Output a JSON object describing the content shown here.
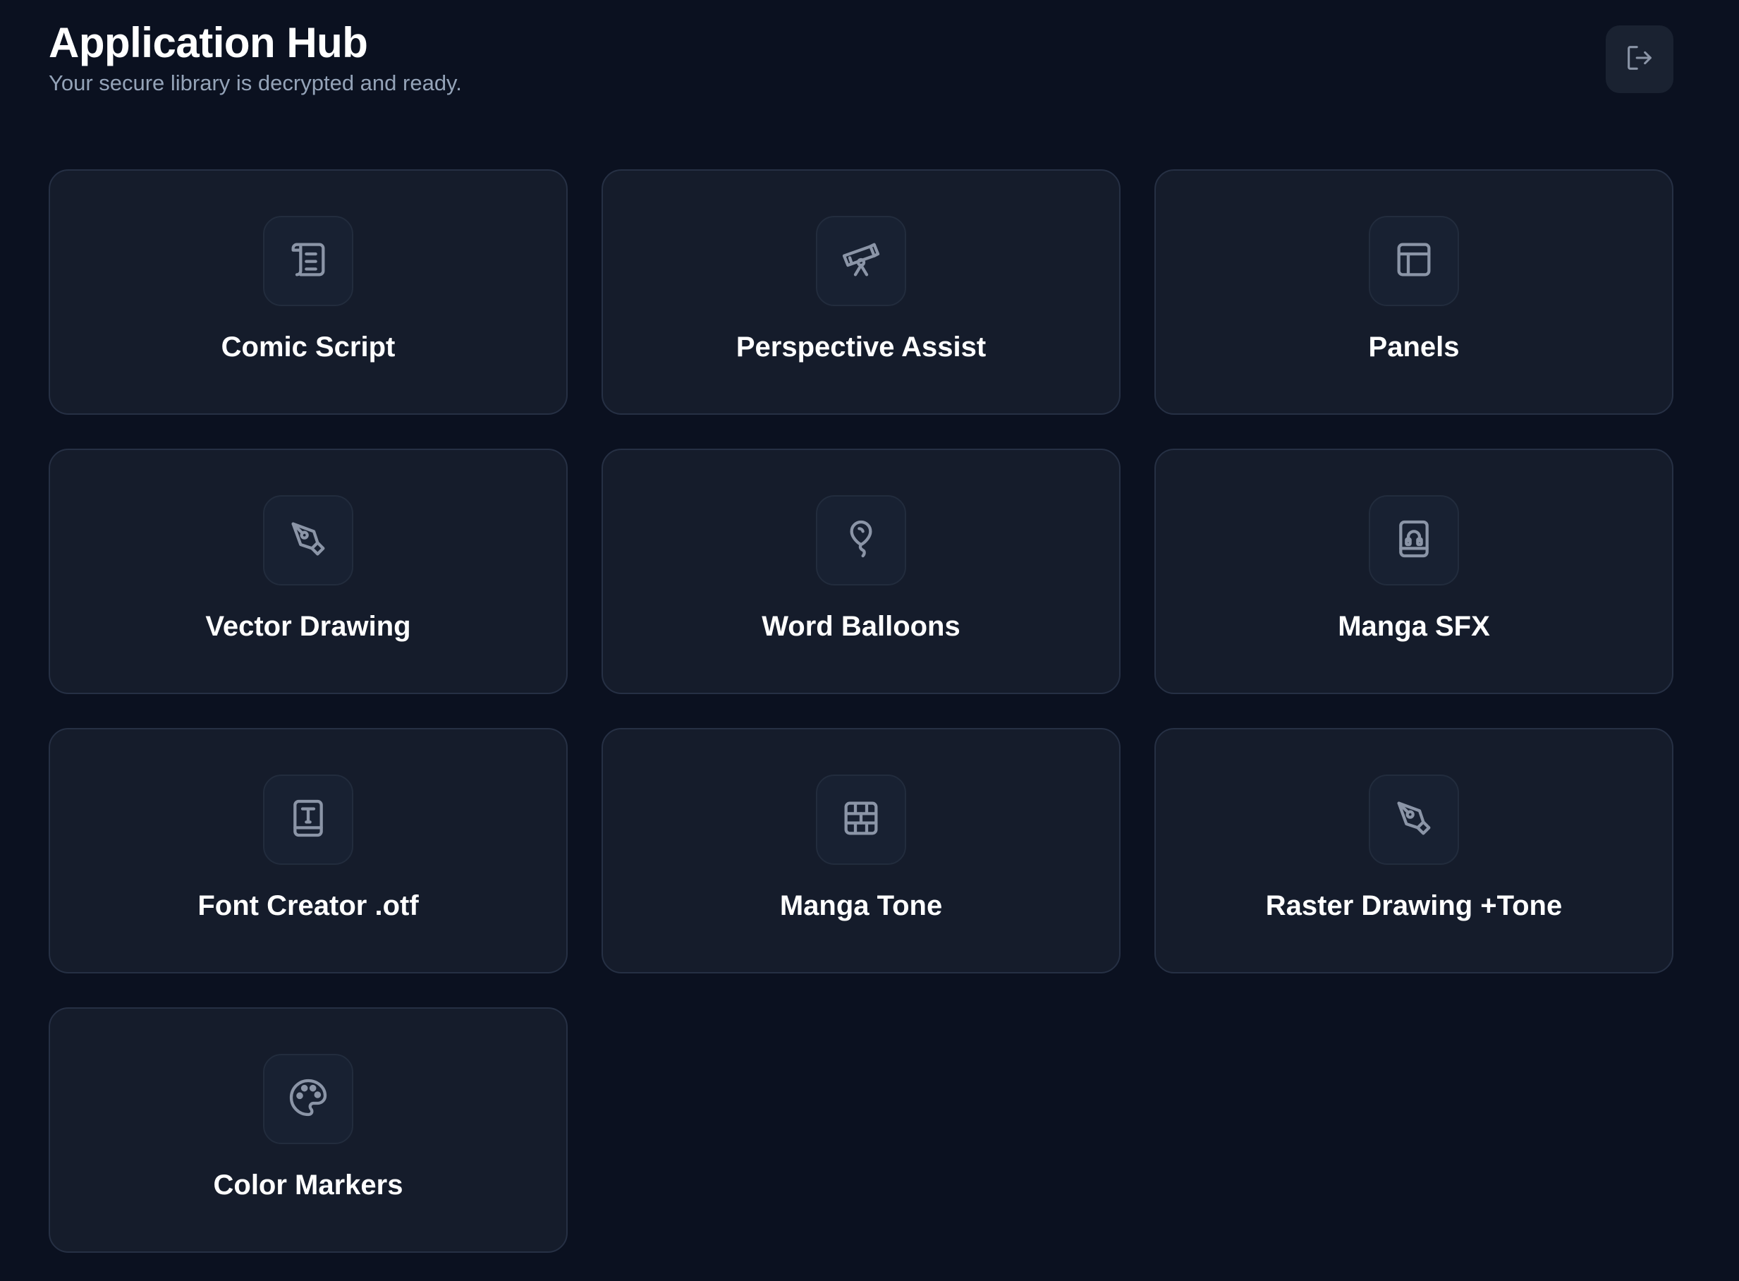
{
  "header": {
    "title": "Application Hub",
    "subtitle": "Your secure library is decrypted and ready."
  },
  "logout_icon": "logout-icon",
  "colors": {
    "background": "#0b1120",
    "card": "#151c2b",
    "card_border": "#263044",
    "icon": "#8b95a7",
    "subtitle": "#94a3b8"
  },
  "apps": [
    {
      "label": "Comic Script",
      "icon": "script-icon"
    },
    {
      "label": "Perspective Assist",
      "icon": "telescope-icon"
    },
    {
      "label": "Panels",
      "icon": "layout-icon"
    },
    {
      "label": "Vector Drawing",
      "icon": "pen-nib-icon"
    },
    {
      "label": "Word Balloons",
      "icon": "balloon-icon"
    },
    {
      "label": "Manga SFX",
      "icon": "audio-book-icon"
    },
    {
      "label": "Font Creator .otf",
      "icon": "text-book-icon"
    },
    {
      "label": "Manga Tone",
      "icon": "tone-grid-icon"
    },
    {
      "label": "Raster Drawing +Tone",
      "icon": "pen-nib-icon"
    },
    {
      "label": "Color Markers",
      "icon": "palette-icon"
    }
  ]
}
